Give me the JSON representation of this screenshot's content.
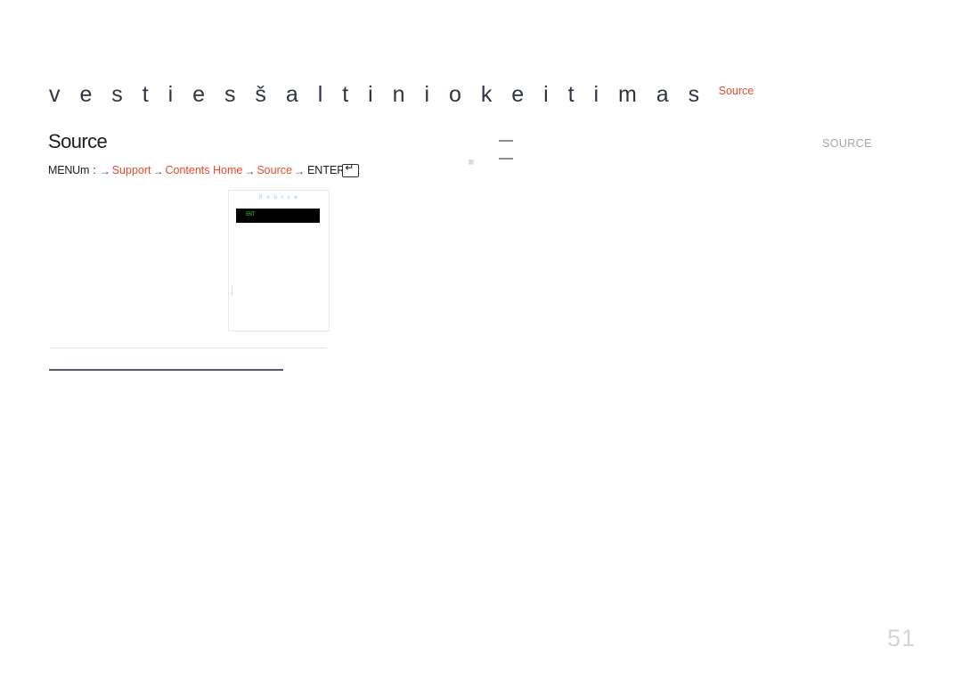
{
  "page": {
    "title": "v e s t i e s š a l t i n i o k e i t i m a s",
    "title_superscript": "Source",
    "number": "51"
  },
  "section": {
    "heading": "Source"
  },
  "breadcrumb": {
    "menu_label": "MENUm",
    "colon": ":",
    "arrow": "→",
    "items": [
      {
        "label": "Support",
        "type": "link"
      },
      {
        "label": "Contents Home",
        "type": "link"
      },
      {
        "label": "Source",
        "type": "link"
      }
    ],
    "enter_label": "ENTER",
    "enter_key_icon": "enter-key-icon"
  },
  "tv_mock": {
    "title": "S o u r c e",
    "selected_item": "ENT",
    "tick": "list-tick-mark"
  },
  "right_marks": {
    "dashes": [
      "—",
      "—"
    ],
    "mini_glyph": "▦"
  },
  "source_label": {
    "text": "SOURCE"
  },
  "footer": {
    "tiny_mark": "·"
  },
  "colors": {
    "accent_red": "#e8482b",
    "title_navy": "#2f3545",
    "tv_title_blue": "#7ec6f2",
    "tv_select_green": "#2ecc2e",
    "rule_dark": "#55576a",
    "muted_gray": "#a5a5a5",
    "page_number_gray": "#d4d4d4"
  }
}
